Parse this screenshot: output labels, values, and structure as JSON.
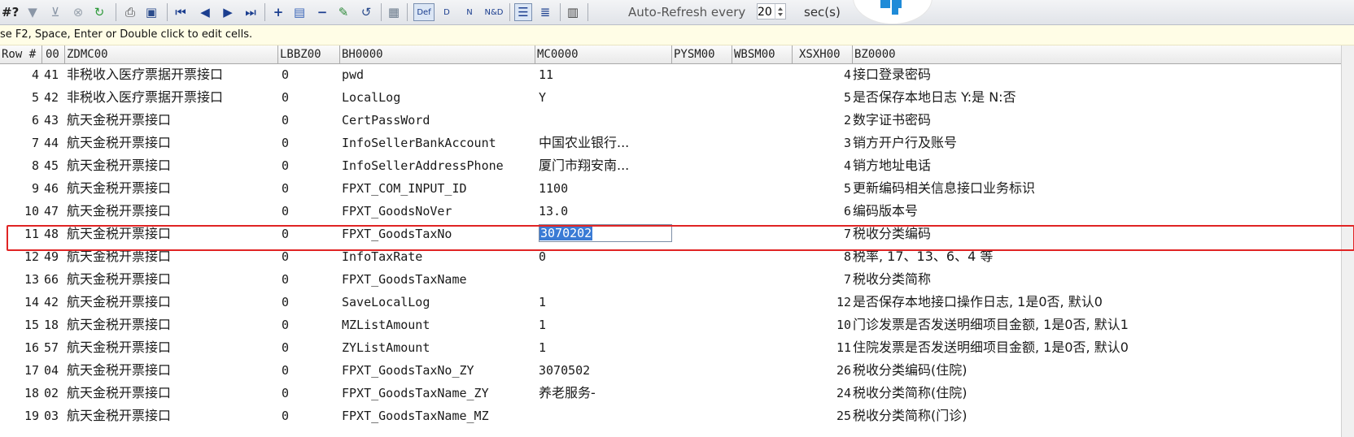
{
  "toolbar": {
    "leading_text": "#?",
    "refresh_label": "Auto-Refresh every",
    "refresh_value": "20",
    "refresh_unit": "sec(s)",
    "def_label": "Def",
    "d_label": "D",
    "n_label": "N",
    "nd_label": "N&D"
  },
  "hint": "se F2, Space, Enter or Double click to edit cells.",
  "columns": [
    "Row #",
    "00",
    "ZDMC00",
    "LBBZ00",
    "BH0000",
    "MC0000",
    "PYSM00",
    "WBSM00",
    "XSXH00",
    "BZ0000"
  ],
  "rows": [
    {
      "row": "4",
      "id": "41",
      "zdmc": "非税收入医疗票据开票接口",
      "lbbz": "0",
      "bh": "pwd",
      "mc": "11",
      "xsxh": "4",
      "bz": "接口登录密码"
    },
    {
      "row": "5",
      "id": "42",
      "zdmc": "非税收入医疗票据开票接口",
      "lbbz": "0",
      "bh": "LocalLog",
      "mc": "Y",
      "xsxh": "5",
      "bz": "是否保存本地日志 Y:是 N:否"
    },
    {
      "row": "6",
      "id": "43",
      "zdmc": "航天金税开票接口",
      "lbbz": "0",
      "bh": "CertPassWord",
      "mc": "",
      "xsxh": "2",
      "bz": "数字证书密码"
    },
    {
      "row": "7",
      "id": "44",
      "zdmc": "航天金税开票接口",
      "lbbz": "0",
      "bh": "InfoSellerBankAccount",
      "mc": "中国农业银行...",
      "xsxh": "3",
      "bz": "销方开户行及账号"
    },
    {
      "row": "8",
      "id": "45",
      "zdmc": "航天金税开票接口",
      "lbbz": "0",
      "bh": "InfoSellerAddressPhone",
      "mc": "厦门市翔安南...",
      "xsxh": "4",
      "bz": "销方地址电话"
    },
    {
      "row": "9",
      "id": "46",
      "zdmc": "航天金税开票接口",
      "lbbz": "0",
      "bh": "FPXT_COM_INPUT_ID",
      "mc": "1100",
      "xsxh": "5",
      "bz": "更新编码相关信息接口业务标识"
    },
    {
      "row": "10",
      "id": "47",
      "zdmc": "航天金税开票接口",
      "lbbz": "0",
      "bh": "FPXT_GoodsNoVer",
      "mc": "13.0",
      "xsxh": "6",
      "bz": "编码版本号"
    },
    {
      "row": "11",
      "id": "48",
      "zdmc": "航天金税开票接口",
      "lbbz": "0",
      "bh": "FPXT_GoodsTaxNo",
      "mc": "3070202",
      "xsxh": "7",
      "bz": "税收分类编码",
      "editing": true
    },
    {
      "row": "12",
      "id": "49",
      "zdmc": "航天金税开票接口",
      "lbbz": "0",
      "bh": "InfoTaxRate",
      "mc": "0",
      "xsxh": "8",
      "bz": "税率, 17、13、6、4 等"
    },
    {
      "row": "13",
      "id": "66",
      "zdmc": "航天金税开票接口",
      "lbbz": "0",
      "bh": "FPXT_GoodsTaxName",
      "mc": "",
      "xsxh": "7",
      "bz": "税收分类简称"
    },
    {
      "row": "14",
      "id": "42",
      "zdmc": "航天金税开票接口",
      "lbbz": "0",
      "bh": "SaveLocalLog",
      "mc": "1",
      "xsxh": "12",
      "bz": "是否保存本地接口操作日志, 1是0否, 默认0"
    },
    {
      "row": "15",
      "id": "18",
      "zdmc": "航天金税开票接口",
      "lbbz": "0",
      "bh": "MZListAmount",
      "mc": "1",
      "xsxh": "10",
      "bz": "门诊发票是否发送明细项目金额, 1是0否, 默认1"
    },
    {
      "row": "16",
      "id": "57",
      "zdmc": "航天金税开票接口",
      "lbbz": "0",
      "bh": "ZYListAmount",
      "mc": "1",
      "xsxh": "11",
      "bz": "住院发票是否发送明细项目金额, 1是0否, 默认0"
    },
    {
      "row": "17",
      "id": "04",
      "zdmc": "航天金税开票接口",
      "lbbz": "0",
      "bh": "FPXT_GoodsTaxNo_ZY",
      "mc": "3070502",
      "xsxh": "26",
      "bz": "税收分类编码(住院)"
    },
    {
      "row": "18",
      "id": "02",
      "zdmc": "航天金税开票接口",
      "lbbz": "0",
      "bh": "FPXT_GoodsTaxName_ZY",
      "mc": "养老服务-",
      "xsxh": "24",
      "bz": "税收分类简称(住院)"
    },
    {
      "row": "19",
      "id": "03",
      "zdmc": "航天金税开票接口",
      "lbbz": "0",
      "bh": "FPXT_GoodsTaxName_MZ",
      "mc": "",
      "xsxh": "25",
      "bz": "税收分类简称(门诊)"
    }
  ]
}
